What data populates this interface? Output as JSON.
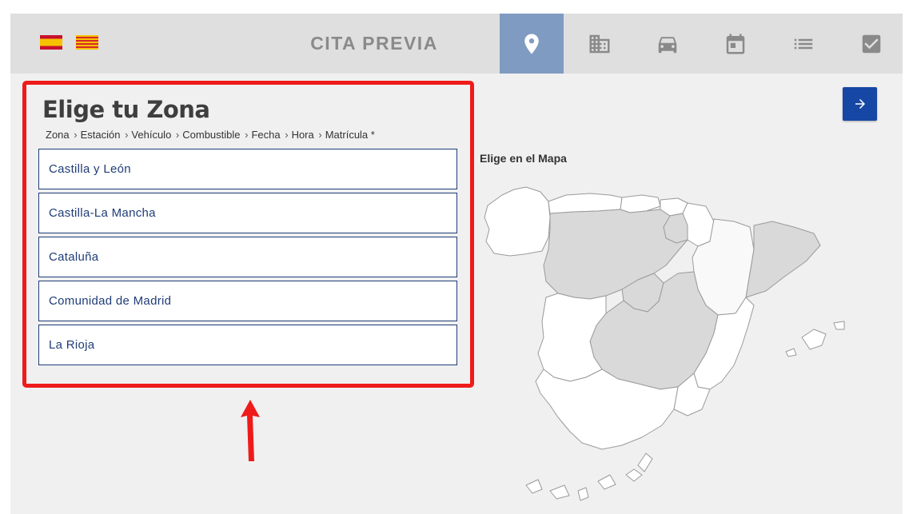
{
  "header": {
    "title": "CITA PREVIA",
    "flags": [
      "spain-flag",
      "catalonia-flag"
    ],
    "steps": [
      {
        "name": "zona",
        "icon": "location-pin-icon",
        "active": true
      },
      {
        "name": "estacion",
        "icon": "building-icon",
        "active": false
      },
      {
        "name": "vehiculo",
        "icon": "car-icon",
        "active": false
      },
      {
        "name": "fecha",
        "icon": "calendar-icon",
        "active": false
      },
      {
        "name": "lista",
        "icon": "list-icon",
        "active": false
      },
      {
        "name": "confirmar",
        "icon": "checkbox-icon",
        "active": false
      }
    ],
    "active_color": "#7f9bc2",
    "icon_color": "#8a8a8a"
  },
  "panel": {
    "title": "Elige tu Zona",
    "breadcrumb": [
      "Zona",
      "Estación",
      "Vehículo",
      "Combustible",
      "Fecha",
      "Hora",
      "Matrícula *"
    ],
    "zones": [
      "Castilla y León",
      "Castilla-La Mancha",
      "Cataluña",
      "Comunidad de Madrid",
      "La Rioja"
    ],
    "highlight_color": "#ef1b1b"
  },
  "map": {
    "label": "Elige en el Mapa",
    "highlighted_regions": [
      "Castilla y León",
      "Castilla-La Mancha",
      "Cataluña",
      "Comunidad de Madrid",
      "La Rioja"
    ],
    "highlight_fill": "#d9d9d9"
  },
  "next_button": {
    "icon": "arrow-right-icon",
    "color": "#1747a5"
  }
}
